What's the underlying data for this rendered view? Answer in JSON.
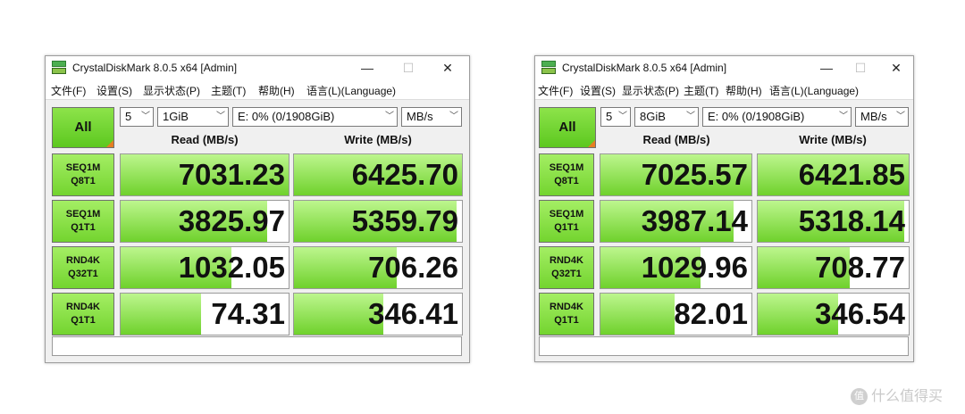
{
  "windows": [
    {
      "title": "CrystalDiskMark 8.0.5 x64 [Admin]",
      "controls": {
        "minimize": "—",
        "maximize": "☐",
        "close": "✕"
      },
      "menu": [
        "文件(F)",
        "设置(S)",
        "显示状态(P)",
        "主题(T)",
        "帮助(H)",
        "语言(L)(Language)"
      ],
      "all_label": "All",
      "count": "5",
      "size": "1GiB",
      "drive": "E: 0% (0/1908GiB)",
      "unit": "MB/s",
      "read_header": "Read (MB/s)",
      "write_header": "Write (MB/s)",
      "rows": [
        {
          "line1": "SEQ1M",
          "line2": "Q8T1",
          "read": "7031.23",
          "write": "6425.70",
          "read_level": 1.0,
          "write_level": 1.0
        },
        {
          "line1": "SEQ1M",
          "line2": "Q1T1",
          "read": "3825.97",
          "write": "5359.79",
          "read_level": 0.87,
          "write_level": 0.97
        },
        {
          "line1": "RND4K",
          "line2": "Q32T1",
          "read": "1032.05",
          "write": "706.26",
          "read_level": 0.66,
          "write_level": 0.61
        },
        {
          "line1": "RND4K",
          "line2": "Q1T1",
          "read": "74.31",
          "write": "346.41",
          "read_level": 0.48,
          "write_level": 0.53
        }
      ]
    },
    {
      "title": "CrystalDiskMark 8.0.5 x64 [Admin]",
      "controls": {
        "minimize": "—",
        "maximize": "☐",
        "close": "✕"
      },
      "menu": [
        "文件(F)",
        "设置(S)",
        "显示状态(P)",
        "主题(T)",
        "帮助(H)",
        "语言(L)(Language)"
      ],
      "all_label": "All",
      "count": "5",
      "size": "8GiB",
      "drive": "E: 0% (0/1908GiB)",
      "unit": "MB/s",
      "read_header": "Read (MB/s)",
      "write_header": "Write (MB/s)",
      "rows": [
        {
          "line1": "SEQ1M",
          "line2": "Q8T1",
          "read": "7025.57",
          "write": "6421.85",
          "read_level": 1.0,
          "write_level": 1.0
        },
        {
          "line1": "SEQ1M",
          "line2": "Q1T1",
          "read": "3987.14",
          "write": "5318.14",
          "read_level": 0.88,
          "write_level": 0.97
        },
        {
          "line1": "RND4K",
          "line2": "Q32T1",
          "read": "1029.96",
          "write": "708.77",
          "read_level": 0.66,
          "write_level": 0.61
        },
        {
          "line1": "RND4K",
          "line2": "Q1T1",
          "read": "82.01",
          "write": "346.54",
          "read_level": 0.49,
          "write_level": 0.53
        }
      ]
    }
  ],
  "watermark": {
    "logo_text": "值",
    "text": "什么值得买"
  },
  "colors": {
    "bar_green": "#6fd12c",
    "label_green": "#8de34a",
    "panel_bg": "#f0f0f0",
    "corner_orange": "#e67e22"
  }
}
